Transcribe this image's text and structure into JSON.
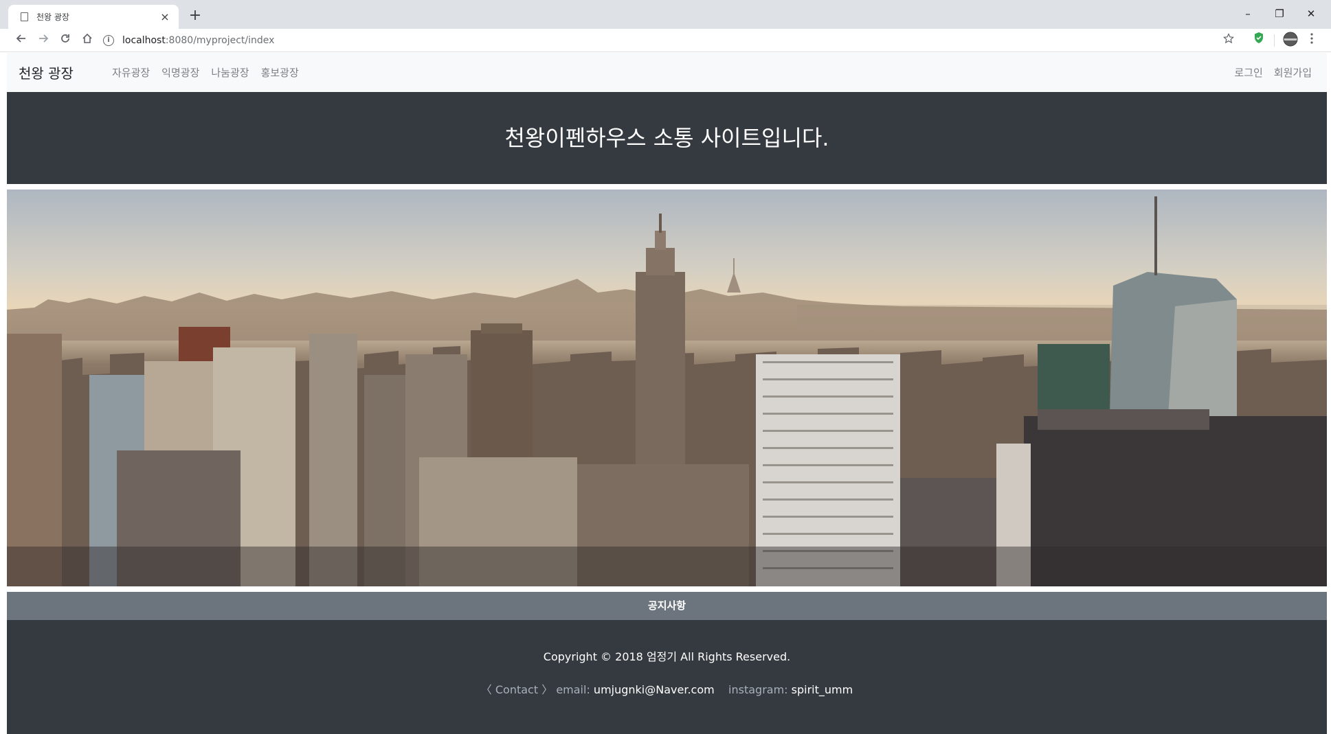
{
  "browser": {
    "tab_title": "천왕 광장",
    "url_host": "localhost",
    "url_path": ":8080/myproject/index",
    "new_tab": "+",
    "tab_close": "×",
    "minimize": "–",
    "restore": "❐",
    "close": "✕"
  },
  "nav": {
    "brand": "천왕 광장",
    "links": [
      "자유광장",
      "익명광장",
      "나눔광장",
      "홍보광장"
    ],
    "login": "로그인",
    "signup": "회원가입"
  },
  "hero": {
    "title": "천왕이펜하우스 소통 사이트입니다."
  },
  "notice": {
    "label": "공지사항"
  },
  "footer": {
    "copyright": "Copyright © 2018 엄정기 All Rights Reserved.",
    "contact_label": "〈 Contact 〉",
    "email_label": "email:",
    "email_value": "umjugnki@Naver.com",
    "instagram_label": "instagram:",
    "instagram_value": "spirit_umm"
  },
  "colors": {
    "navbar_bg": "#f8f9fa",
    "dark_bg": "#343a40",
    "notice_bg": "#6c757d",
    "shield_green": "#34a853"
  }
}
